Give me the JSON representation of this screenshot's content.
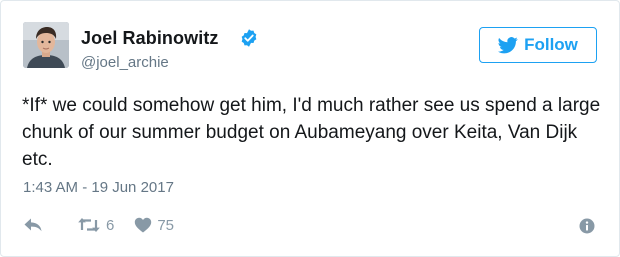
{
  "tweet": {
    "author_name": "Joel Rabinowitz",
    "handle": "@joel_archie",
    "text": "*If* we could somehow get him, I'd much rather see us spend a large chunk of our summer budget on Aubameyang over Keita, Van Dijk etc.",
    "timestamp": "1:43 AM - 19 Jun 2017"
  },
  "follow_button": {
    "label": "Follow",
    "icon": "twitter-bird-icon"
  },
  "actions": {
    "reply_icon": "reply-icon",
    "retweet_icon": "retweet-icon",
    "retweet_count": "6",
    "like_icon": "heart-icon",
    "like_count": "75",
    "info_icon": "info-icon"
  },
  "colors": {
    "accent": "#1da1f2",
    "name": "#14171a",
    "secondary": "#657786",
    "action": "#8899a6",
    "border": "#e1e8ed"
  }
}
